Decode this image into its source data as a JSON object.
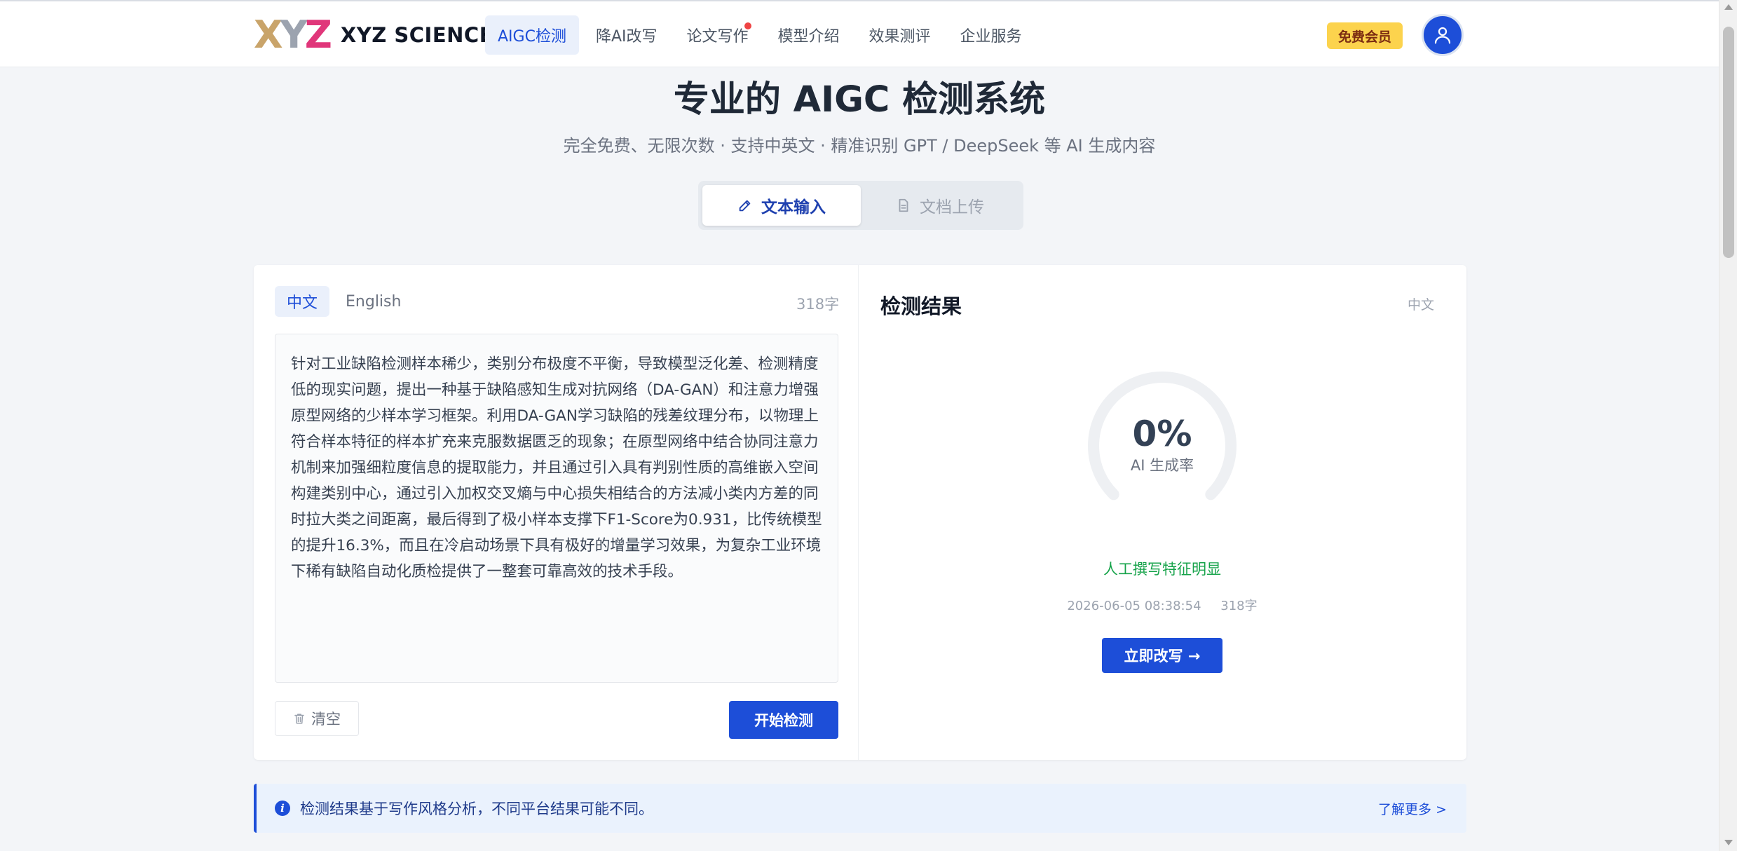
{
  "header": {
    "logo_letters": [
      "X",
      "Y",
      "Z"
    ],
    "logo_colors": [
      "#c9a46a",
      "#9ca3af",
      "#e0367a"
    ],
    "brand": "XYZ SCIENCE",
    "nav": [
      {
        "label": "AIGC检测",
        "active": true
      },
      {
        "label": "降AI改写",
        "active": false
      },
      {
        "label": "论文写作",
        "active": false,
        "dot": true
      },
      {
        "label": "模型介绍",
        "active": false
      },
      {
        "label": "效果测评",
        "active": false
      },
      {
        "label": "企业服务",
        "active": false
      }
    ],
    "member_badge": "免费会员",
    "avatar_icon": "user-icon"
  },
  "hero": {
    "title": "专业的 AIGC 检测系统",
    "subtitle": "完全免费、无限次数 · 支持中英文 · 精准识别 GPT / DeepSeek 等 AI 生成内容",
    "tabs": [
      {
        "label": "文本输入",
        "icon": "pencil-icon",
        "active": true
      },
      {
        "label": "文档上传",
        "icon": "document-icon",
        "active": false
      }
    ]
  },
  "input_panel": {
    "lang_tabs": [
      {
        "label": "中文",
        "active": true
      },
      {
        "label": "English",
        "active": false
      }
    ],
    "char_count": "318字",
    "text": "针对工业缺陷检测样本稀少，类别分布极度不平衡，导致模型泛化差、检测精度低的现实问题，提出一种基于缺陷感知生成对抗网络（DA-GAN）和注意力增强原型网络的少样本学习框架。利用DA-GAN学习缺陷的残差纹理分布，以物理上符合样本特征的样本扩充来克服数据匮乏的现象；在原型网络中结合协同注意力机制来加强细粒度信息的提取能力，并且通过引入具有判别性质的高维嵌入空间构建类别中心，通过引入加权交叉熵与中心损失相结合的方法减小类内方差的同时拉大类之间距离，最后得到了极小样本支撑下F1-Score为0.931，比传统模型的提升16.3%，而且在冷启动场景下具有极好的增量学习效果，为复杂工业环境下稀有缺陷自动化质检提供了一整套可靠高效的技术手段。",
    "clear_label": "清空",
    "start_label": "开始检测"
  },
  "result_panel": {
    "title": "检测结果",
    "lang": "中文",
    "ai_rate": "0%",
    "ai_rate_value": 0,
    "ai_rate_label": "AI 生成率",
    "verdict": "人工撰写特征明显",
    "timestamp": "2026-06-05 08:38:54",
    "char_count": "318字",
    "rewrite_label": "立即改写 →"
  },
  "notice": {
    "text": "检测结果基于写作风格分析，不同平台结果可能不同。",
    "link": "了解更多 >"
  },
  "colors": {
    "accent": "#1d4ed8",
    "verdict_green": "#16a34a",
    "badge_yellow": "#fcd34d"
  }
}
